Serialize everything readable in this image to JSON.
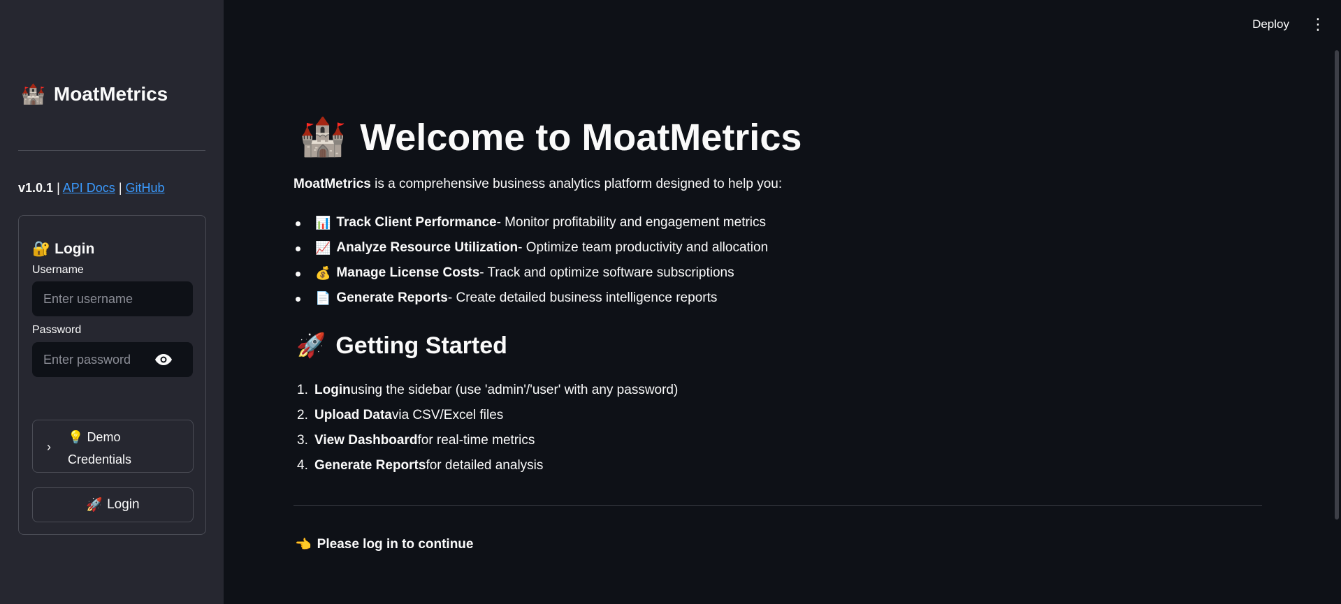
{
  "header": {
    "deploy_label": "Deploy",
    "menu_icon": "kebab-menu-icon"
  },
  "sidebar": {
    "brand_emoji": "🏰",
    "brand_title": "MoatMetrics",
    "version": "v1.0.1",
    "separator": "|",
    "api_docs_label": "API Docs",
    "github_label": "GitHub",
    "login_form": {
      "title_emoji": "🔐",
      "title": "Login",
      "username_label": "Username",
      "username_value": "",
      "username_placeholder": "Enter username",
      "password_label": "Password",
      "password_value": "",
      "password_placeholder": "Enter password",
      "expander_emoji": "💡",
      "expander_label": "Demo Credentials",
      "login_button_emoji": "🚀",
      "login_button_label": "Login"
    }
  },
  "main": {
    "title_emoji": "🏰",
    "title": "Welcome to MoatMetrics",
    "intro_strong": "MoatMetrics",
    "intro_rest": " is a comprehensive business analytics platform designed to help you:",
    "features": [
      {
        "emoji": "📊",
        "title": "Track Client Performance",
        "desc": " - Monitor profitability and engagement metrics"
      },
      {
        "emoji": "📈",
        "title": "Analyze Resource Utilization",
        "desc": " - Optimize team productivity and allocation"
      },
      {
        "emoji": "💰",
        "title": "Manage License Costs",
        "desc": " - Track and optimize software subscriptions"
      },
      {
        "emoji": "📄",
        "title": "Generate Reports",
        "desc": " - Create detailed business intelligence reports"
      }
    ],
    "getting_started_emoji": "🚀",
    "getting_started_title": "Getting Started",
    "steps": [
      {
        "num": "1.",
        "title": "Login",
        "desc": " using the sidebar (use 'admin'/'user' with any password)"
      },
      {
        "num": "2.",
        "title": "Upload Data",
        "desc": " via CSV/Excel files"
      },
      {
        "num": "3.",
        "title": "View Dashboard",
        "desc": " for real-time metrics"
      },
      {
        "num": "4.",
        "title": "Generate Reports",
        "desc": " for detailed analysis"
      }
    ],
    "notice_emoji": "👈",
    "notice_text": "Please log in to continue"
  },
  "colors": {
    "background": "#0e1117",
    "sidebar": "#262730",
    "link": "#3b9bff",
    "text": "#fafafa"
  }
}
